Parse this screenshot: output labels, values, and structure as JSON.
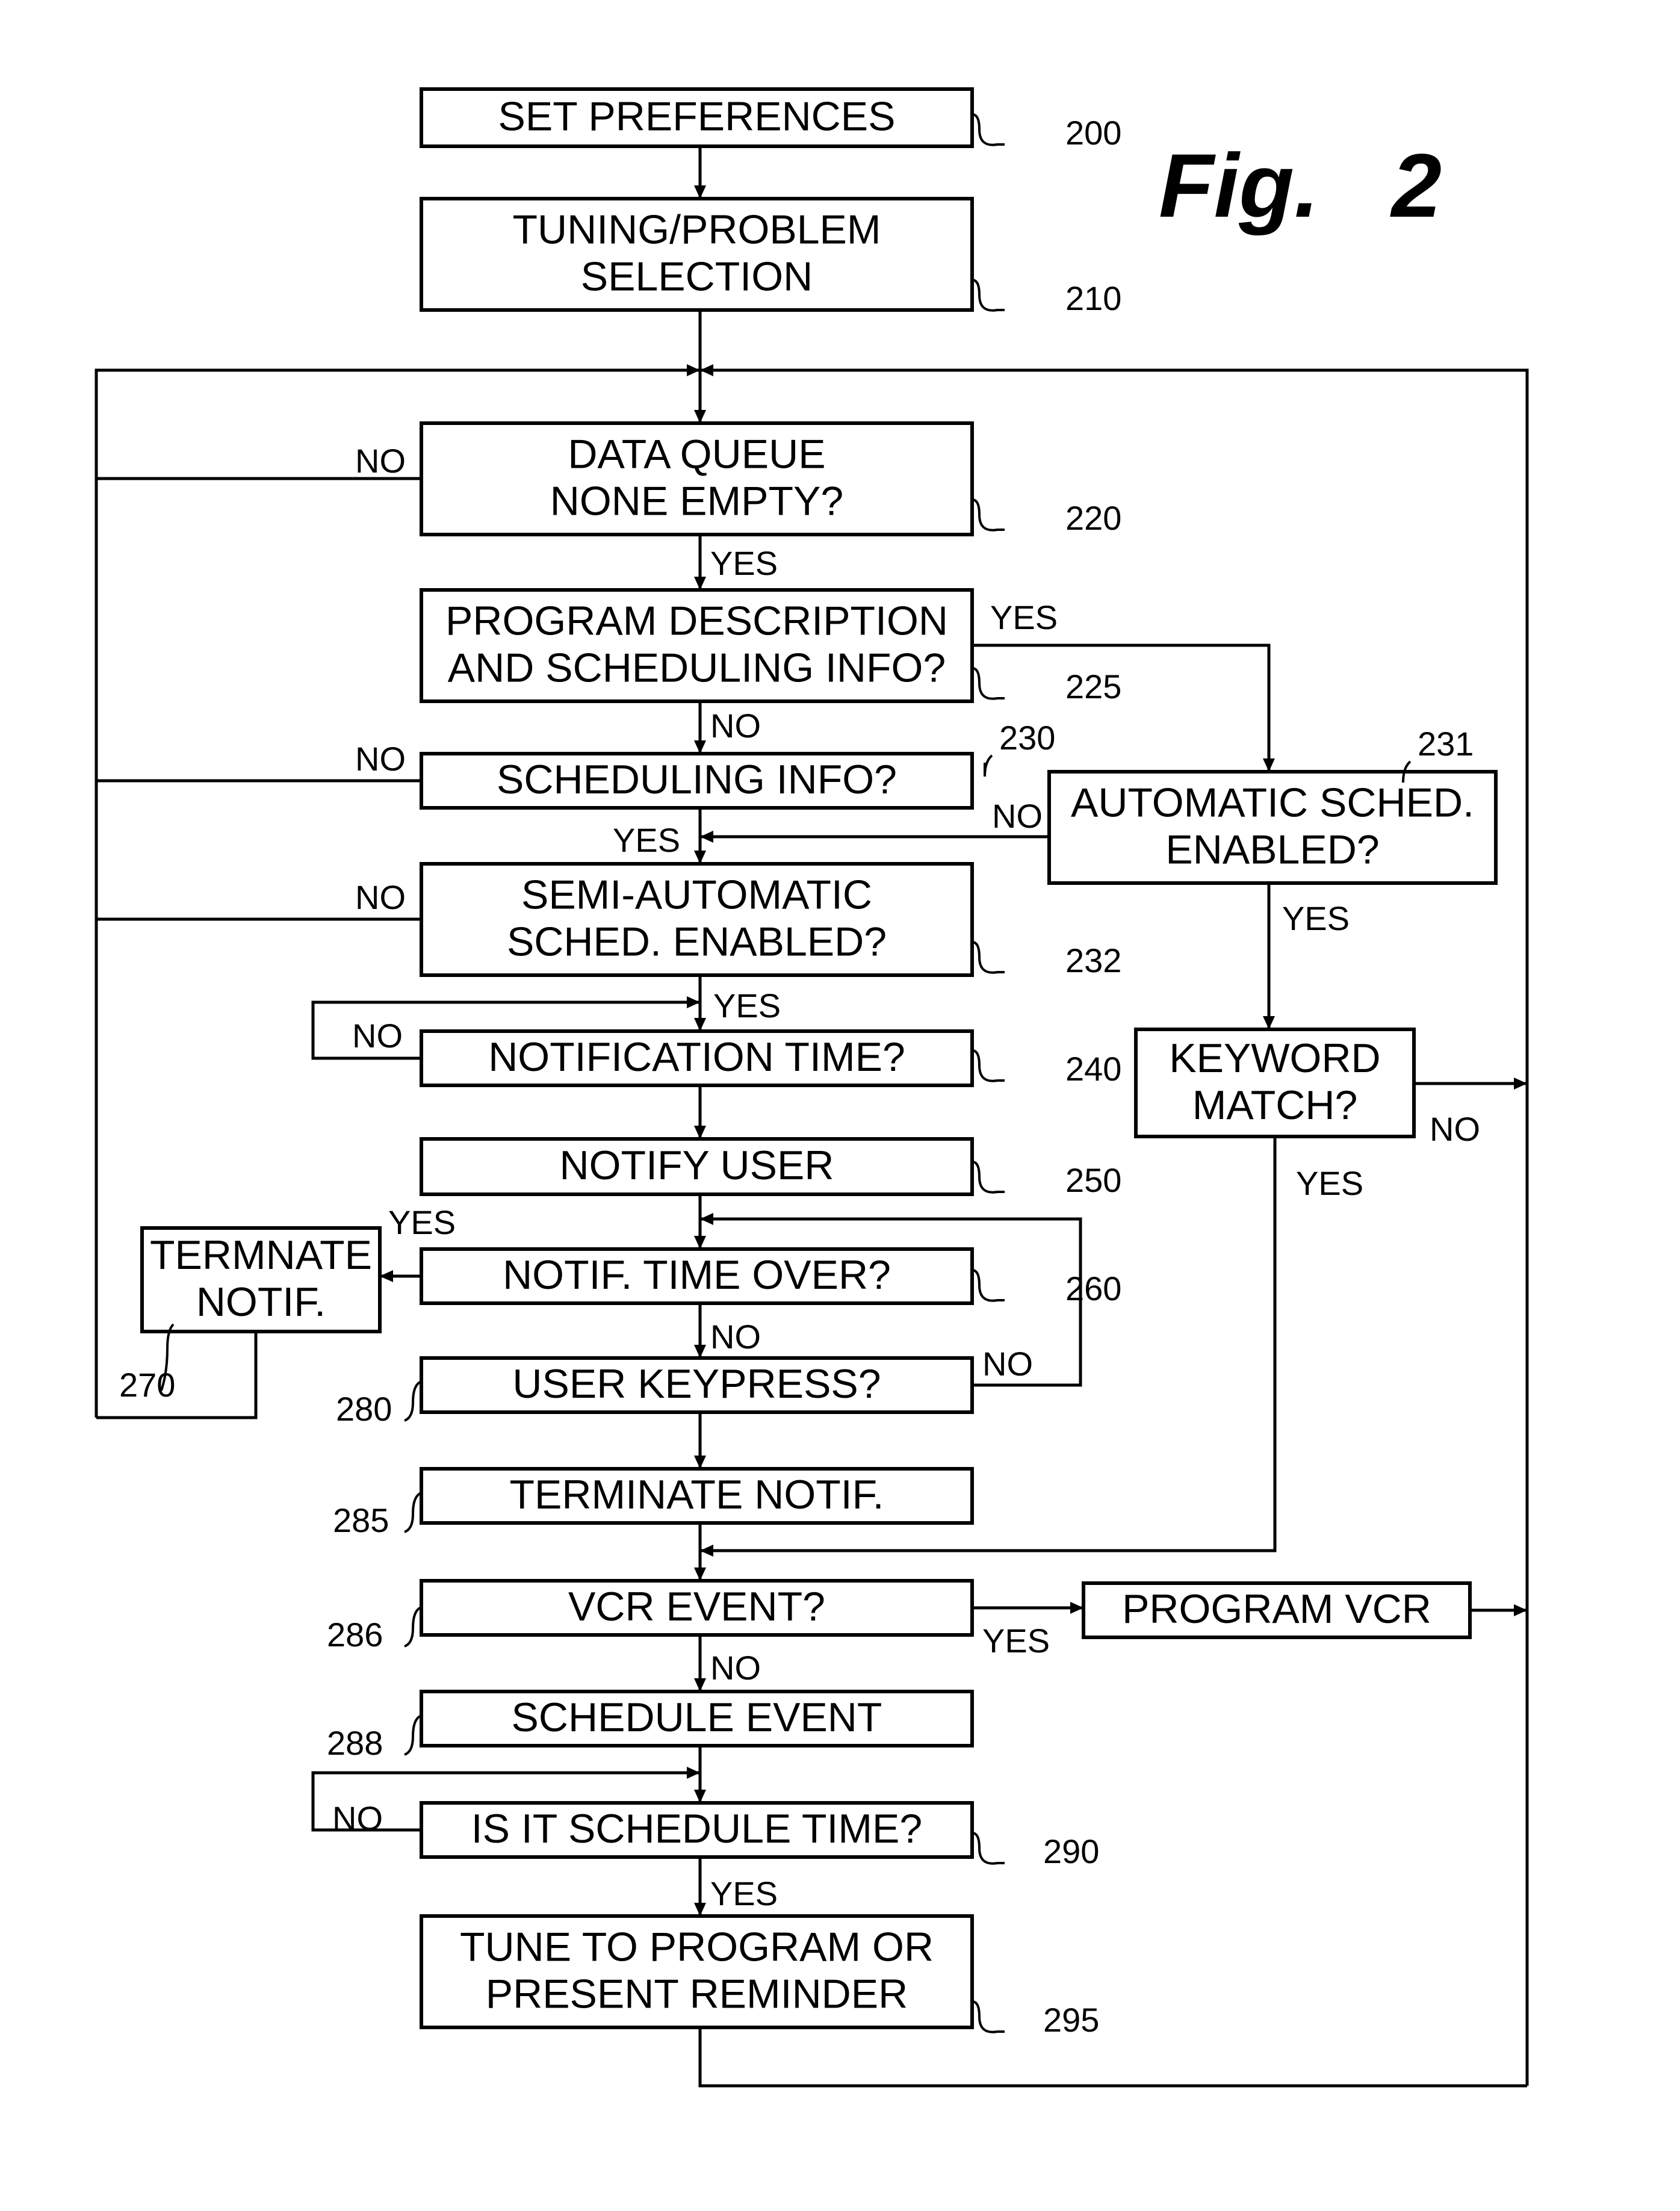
{
  "figure": {
    "title": "Fig.",
    "number": "2"
  },
  "nodes": [
    {
      "id": "200",
      "ref": "200",
      "lines": [
        "SET PREFERENCES"
      ]
    },
    {
      "id": "210",
      "ref": "210",
      "lines": [
        "TUNING/PROBLEM",
        "SELECTION"
      ]
    },
    {
      "id": "220",
      "ref": "220",
      "lines": [
        "DATA QUEUE",
        "NONE EMPTY?"
      ]
    },
    {
      "id": "225",
      "ref": "225",
      "lines": [
        "PROGRAM DESCRIPTION",
        "AND SCHEDULING INFO?"
      ]
    },
    {
      "id": "230",
      "ref": "230",
      "lines": [
        "SCHEDULING INFO?"
      ]
    },
    {
      "id": "231",
      "ref": "231",
      "lines": [
        "AUTOMATIC SCHED.",
        "ENABLED?"
      ]
    },
    {
      "id": "232",
      "ref": "232",
      "lines": [
        "SEMI-AUTOMATIC",
        "SCHED. ENABLED?"
      ]
    },
    {
      "id": "240",
      "ref": "240",
      "lines": [
        "NOTIFICATION TIME?"
      ]
    },
    {
      "id": "keyword",
      "ref": "",
      "lines": [
        "KEYWORD",
        "MATCH?"
      ]
    },
    {
      "id": "250",
      "ref": "250",
      "lines": [
        "NOTIFY USER"
      ]
    },
    {
      "id": "260",
      "ref": "260",
      "lines": [
        "NOTIF. TIME OVER?"
      ]
    },
    {
      "id": "270",
      "ref": "270",
      "lines": [
        "TERMNATE",
        "NOTIF."
      ]
    },
    {
      "id": "280",
      "ref": "280",
      "lines": [
        "USER KEYPRESS?"
      ]
    },
    {
      "id": "285",
      "ref": "285",
      "lines": [
        "TERMINATE NOTIF."
      ]
    },
    {
      "id": "286",
      "ref": "286",
      "lines": [
        "VCR EVENT?"
      ]
    },
    {
      "id": "vcr",
      "ref": "",
      "lines": [
        "PROGRAM VCR"
      ]
    },
    {
      "id": "288",
      "ref": "288",
      "lines": [
        "SCHEDULE EVENT"
      ]
    },
    {
      "id": "290",
      "ref": "290",
      "lines": [
        "IS IT SCHEDULE TIME?"
      ]
    },
    {
      "id": "295",
      "ref": "295",
      "lines": [
        "TUNE TO PROGRAM OR",
        "PRESENT REMINDER"
      ]
    }
  ],
  "branch_labels": [
    {
      "id": "220-no",
      "text": "NO"
    },
    {
      "id": "220-yes",
      "text": "YES"
    },
    {
      "id": "225-yes",
      "text": "YES"
    },
    {
      "id": "225-no",
      "text": "NO"
    },
    {
      "id": "230-no",
      "text": "NO"
    },
    {
      "id": "230-yes",
      "text": "YES"
    },
    {
      "id": "231-no",
      "text": "NO"
    },
    {
      "id": "231-yes",
      "text": "YES"
    },
    {
      "id": "232-no",
      "text": "NO"
    },
    {
      "id": "232-yes",
      "text": "YES"
    },
    {
      "id": "240-no",
      "text": "NO"
    },
    {
      "id": "keyword-no",
      "text": "NO"
    },
    {
      "id": "keyword-yes",
      "text": "YES"
    },
    {
      "id": "260-yes",
      "text": "YES"
    },
    {
      "id": "260-no",
      "text": "NO"
    },
    {
      "id": "280-no",
      "text": "NO"
    },
    {
      "id": "286-yes",
      "text": "YES"
    },
    {
      "id": "286-no",
      "text": "NO"
    },
    {
      "id": "290-no",
      "text": "NO"
    },
    {
      "id": "290-yes",
      "text": "YES"
    }
  ]
}
